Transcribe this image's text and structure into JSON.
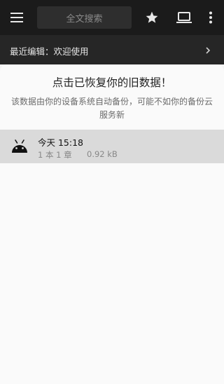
{
  "topbar": {
    "search_placeholder": "全文搜索",
    "menu_icon": "hamburger-menu-icon",
    "star_icon": "star-icon",
    "laptop_icon": "laptop-icon",
    "more_icon": "more-vertical-icon"
  },
  "recent": {
    "label": "最近编辑：欢迎使用",
    "chevron_icon": "chevron-right-icon"
  },
  "sheet": {
    "title": "点击已恢复你的旧数据！",
    "description": "该数据由你的设备系统自动备份，可能不如你的备份云服务新",
    "items": [
      {
        "icon": "android-icon",
        "date": "今天 15:18",
        "count": "1 本 1 章",
        "size": "0.92 kB"
      }
    ]
  },
  "colors": {
    "topbar_bg": "#1b1b1b",
    "recent_bg": "#262626",
    "sheet_bg": "#fafafa",
    "item_highlight": "#dadada"
  }
}
